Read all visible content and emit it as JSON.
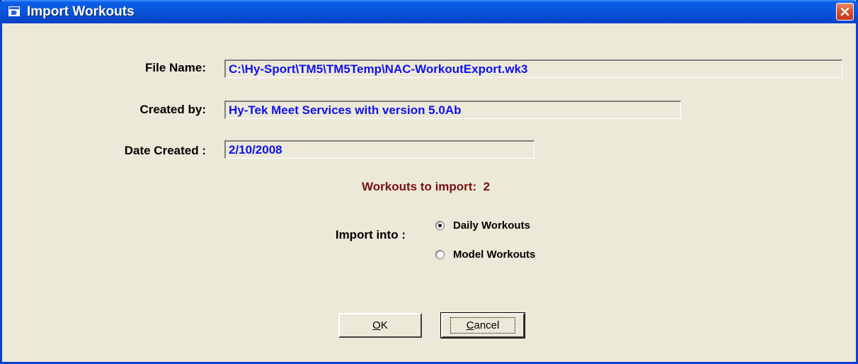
{
  "window": {
    "title": "Import Workouts"
  },
  "form": {
    "file_name_label": "File Name:",
    "file_name_value": "C:\\Hy-Sport\\TM5\\TM5Temp\\NAC-WorkoutExport.wk3",
    "created_by_label": "Created by:",
    "created_by_value": "Hy-Tek Meet Services with version 5.0Ab",
    "date_created_label": "Date Created :",
    "date_created_value": "2/10/2008"
  },
  "summary": {
    "label": "Workouts to import:",
    "count": "2"
  },
  "import_into": {
    "label": "Import into :",
    "options": [
      {
        "label": "Daily Workouts",
        "selected": true
      },
      {
        "label": "Model Workouts",
        "selected": false
      }
    ]
  },
  "buttons": {
    "ok_mnemonic": "O",
    "ok_rest": "K",
    "cancel_mnemonic": "C",
    "cancel_rest": "ancel"
  },
  "colors": {
    "title_bar": "#0a54dc",
    "field_text": "#1010ee",
    "count_text": "#7a1010",
    "dialog_bg": "#ece9d8"
  }
}
